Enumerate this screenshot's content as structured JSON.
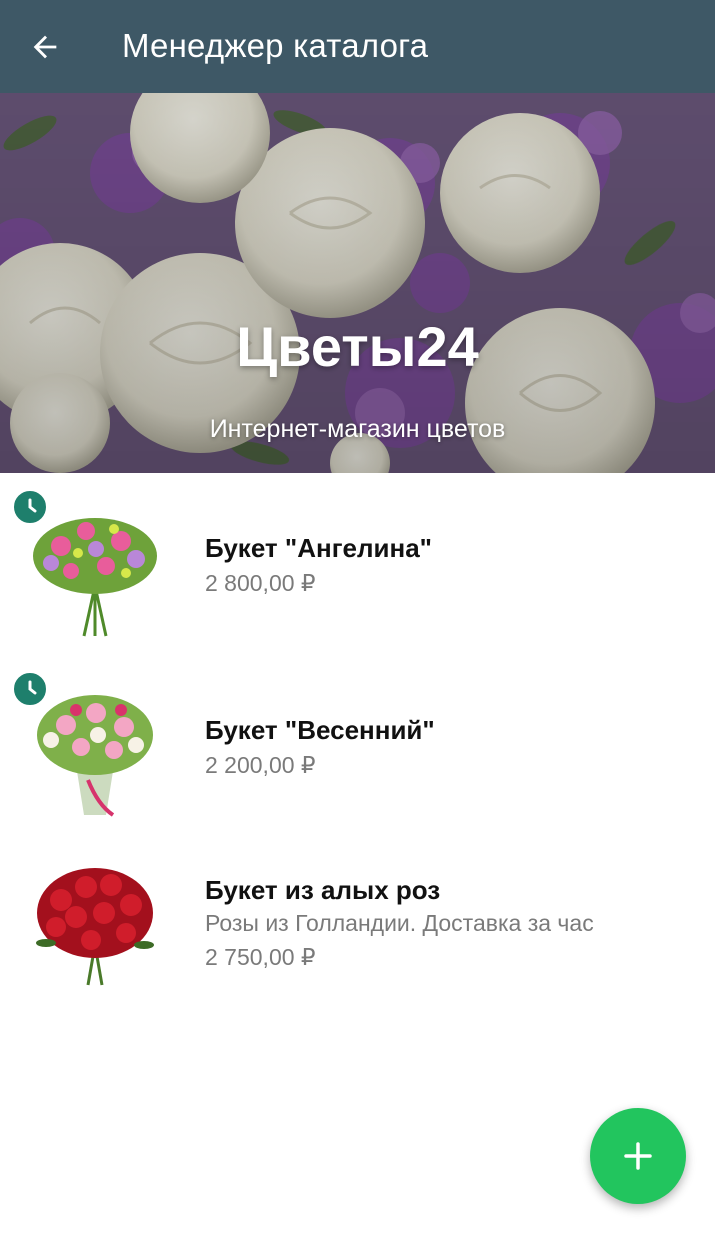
{
  "appbar": {
    "title": "Менеджер каталога",
    "back_icon": "arrow-left-icon",
    "background": "#3e5866"
  },
  "hero": {
    "title": "Цветы24",
    "subtitle": "Интернет-магазин цветов"
  },
  "products": [
    {
      "name": "Букет \"Ангелина\"",
      "description": "",
      "price": "2 800,00 ₽",
      "scheduled": true
    },
    {
      "name": "Букет \"Весенний\"",
      "description": "",
      "price": "2 200,00 ₽",
      "scheduled": true
    },
    {
      "name": "Букет из алых роз",
      "description": "Розы из Голландии. Доставка за час",
      "price": "2 750,00 ₽",
      "scheduled": false
    }
  ],
  "fab": {
    "icon": "plus-icon",
    "color": "#22c55e"
  },
  "colors": {
    "accent_teal": "#1e7f6c",
    "muted_text": "#7a7a7a"
  }
}
